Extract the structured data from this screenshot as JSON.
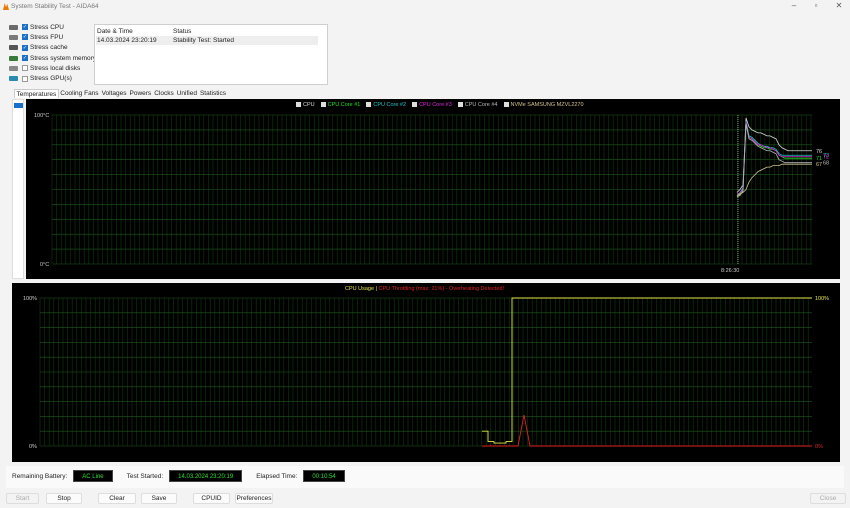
{
  "window": {
    "title": "System Stability Test - AIDA64",
    "minimize": "–",
    "maximize": "▫",
    "close": "✕"
  },
  "stress_options": [
    {
      "label": "Stress CPU",
      "checked": true,
      "icon": "cpu-icon"
    },
    {
      "label": "Stress FPU",
      "checked": true,
      "icon": "fpu-icon"
    },
    {
      "label": "Stress cache",
      "checked": true,
      "icon": "cache-icon"
    },
    {
      "label": "Stress system memory",
      "checked": true,
      "icon": "memory-icon"
    },
    {
      "label": "Stress local disks",
      "checked": false,
      "icon": "disk-icon"
    },
    {
      "label": "Stress GPU(s)",
      "checked": false,
      "icon": "gpu-icon"
    }
  ],
  "log": {
    "headers": [
      "Date & Time",
      "Status"
    ],
    "rows": [
      {
        "datetime": "14.03.2024 23:20:19",
        "status": "Stability Test: Started"
      }
    ]
  },
  "tabs": [
    "Temperatures",
    "Cooling Fans",
    "Voltages",
    "Powers",
    "Clocks",
    "Unified",
    "Statistics"
  ],
  "selected_tab": "Temperatures",
  "temp_chart": {
    "type": "line",
    "y_max_label": "100°C",
    "y_min_label": "0°C",
    "ylim": [
      0,
      100
    ],
    "time_label": "8:26:30",
    "grid": true,
    "series": [
      {
        "name": "CPU",
        "color": "#d8d8d8",
        "checked": true,
        "end_label": "76",
        "values": [
          48,
          50,
          53,
          98,
          92,
          90,
          89,
          88,
          88,
          87,
          86,
          86,
          85,
          84,
          80,
          78,
          77,
          76,
          76,
          76,
          76,
          76,
          76,
          76,
          76,
          76
        ]
      },
      {
        "name": "CPU Core #1",
        "color": "#22e022",
        "checked": true,
        "end_label": "71",
        "values": [
          45,
          47,
          50,
          95,
          85,
          84,
          82,
          80,
          79,
          78,
          78,
          77,
          77,
          76,
          73,
          72,
          71,
          71,
          71,
          71,
          71,
          71,
          71,
          71,
          71,
          71
        ]
      },
      {
        "name": "CPU Core #2",
        "color": "#22c8c8",
        "checked": true,
        "end_label": "73",
        "values": [
          46,
          48,
          51,
          96,
          86,
          85,
          83,
          81,
          80,
          79,
          79,
          78,
          78,
          77,
          74,
          73,
          73,
          73,
          73,
          73,
          73,
          73,
          73,
          73,
          73,
          73
        ]
      },
      {
        "name": "CPU Core #3",
        "color": "#e022e0",
        "checked": true,
        "end_label": "72",
        "values": [
          46,
          48,
          50,
          95,
          85,
          84,
          82,
          80,
          80,
          79,
          78,
          78,
          77,
          76,
          73,
          72,
          72,
          72,
          72,
          72,
          72,
          72,
          72,
          72,
          72,
          72
        ]
      },
      {
        "name": "CPU Core #4",
        "color": "#b8b8b8",
        "checked": true,
        "end_label": "68",
        "values": [
          45,
          46,
          49,
          94,
          84,
          83,
          81,
          79,
          78,
          77,
          76,
          76,
          75,
          74,
          70,
          69,
          68,
          68,
          68,
          68,
          68,
          68,
          68,
          68,
          68,
          68
        ]
      },
      {
        "name": "NVMe SAMSUNG MZVL2270",
        "color": "#d4c28e",
        "checked": true,
        "end_label": "67",
        "values": [
          46,
          47,
          48,
          50,
          55,
          58,
          60,
          62,
          63,
          64,
          65,
          65,
          66,
          66,
          66,
          67,
          67,
          67,
          67,
          67,
          67,
          67,
          67,
          67,
          67,
          67
        ]
      }
    ]
  },
  "cpu_chart": {
    "type": "line",
    "ylim": [
      0,
      100
    ],
    "y_max_label": "100%",
    "y_min_label": "0%",
    "grid": true,
    "title_usage": "CPU Usage",
    "separator": "|",
    "title_throttle": "CPU Throttling (max: 21%) - Overheating Detected!",
    "usage": {
      "color": "#e6e64a",
      "end_label": "100%",
      "values": [
        10,
        3,
        2,
        2,
        3,
        100,
        100,
        100,
        100,
        100,
        100,
        100,
        100,
        100,
        100,
        100,
        100,
        100,
        100,
        100,
        100,
        100,
        100,
        100,
        100,
        100,
        100,
        100,
        100,
        100,
        100,
        100,
        100,
        100,
        100,
        100,
        100,
        100,
        100,
        100,
        100,
        100,
        100,
        100,
        100,
        100,
        100,
        100,
        100,
        100,
        100,
        100,
        100,
        100,
        100,
        100
      ]
    },
    "throttle": {
      "color": "#e02020",
      "end_label": "0%",
      "values": [
        0,
        0,
        0,
        0,
        0,
        0,
        0,
        21,
        0,
        0,
        0,
        0,
        0,
        0,
        0,
        0,
        0,
        0,
        0,
        0,
        0,
        0,
        0,
        0,
        0,
        0,
        0,
        0,
        0,
        0,
        0,
        0,
        0,
        0,
        0,
        0,
        0,
        0,
        0,
        0,
        0,
        0,
        0,
        0,
        0,
        0,
        0,
        0,
        0,
        0,
        0,
        0,
        0,
        0,
        0,
        0
      ]
    }
  },
  "status": {
    "battery_label": "Remaining Battery:",
    "battery_value": "AC Line",
    "started_label": "Test Started:",
    "started_value": "14.03.2024 23:20:19",
    "elapsed_label": "Elapsed Time:",
    "elapsed_value": "00:10:54"
  },
  "buttons": {
    "start": "Start",
    "stop": "Stop",
    "clear": "Clear",
    "save": "Save",
    "cpuid": "CPUID",
    "preferences": "Preferences",
    "close": "Close"
  }
}
